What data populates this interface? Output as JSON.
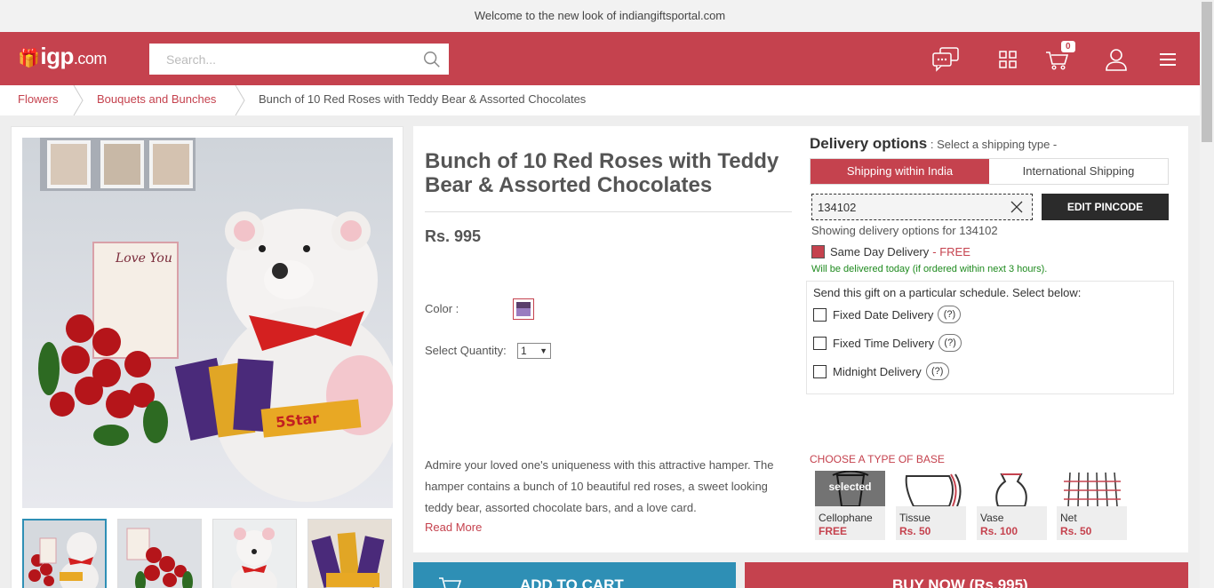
{
  "announcement": "Welcome to the new look of indiangiftsportal.com",
  "header": {
    "logo_main": "igp",
    "logo_suffix": ".com",
    "search_placeholder": "Search...",
    "cart_count": "0",
    "icons": [
      "chat-icon",
      "grid-icon",
      "cart-icon",
      "user-icon",
      "menu-icon"
    ]
  },
  "breadcrumb": {
    "items": [
      "Flowers",
      "Bouquets and Bunches"
    ],
    "current": "Bunch of 10 Red Roses with Teddy Bear & Assorted Chocolates"
  },
  "product": {
    "title": "Bunch of 10 Red Roses with Teddy Bear & Assorted Chocolates",
    "price": "Rs. 995",
    "color_label": "Color :",
    "qty_label": "Select Quantity:",
    "qty_value": "1",
    "description": "Admire your loved one's uniqueness with this attractive hamper. The hamper contains a bunch of 10 beautiful red roses, a sweet looking teddy bear, assorted chocolate bars, and a love card.",
    "read_more": "Read More"
  },
  "delivery": {
    "title": "Delivery options",
    "subtitle": " : Select a shipping type -",
    "tabs": [
      "Shipping within India",
      "International Shipping"
    ],
    "pincode": "134102",
    "edit_button": "EDIT PINCODE",
    "showing_text": "Showing delivery options for 134102",
    "same_day_label": "Same Day Delivery",
    "same_day_price": "- FREE",
    "note": "Will be delivered today (if ordered within next 3 hours).",
    "schedule_head": "Send this gift on a particular schedule. Select below:",
    "schedule_options": [
      "Fixed Date Delivery",
      "Fixed Time Delivery",
      "Midnight Delivery"
    ],
    "help_text": "(?)"
  },
  "base": {
    "title": "CHOOSE A TYPE OF BASE",
    "selected_tag": "selected",
    "options": [
      {
        "name": "Cellophane",
        "price": "FREE"
      },
      {
        "name": "Tissue",
        "price": "Rs. 50"
      },
      {
        "name": "Vase",
        "price": "Rs. 100"
      },
      {
        "name": "Net",
        "price": "Rs. 50"
      }
    ]
  },
  "actions": {
    "add_to_cart": "ADD TO CART",
    "buy_now": "BUY NOW (Rs.995)"
  },
  "colors": {
    "brand": "#c5424e",
    "cart_button": "#2e8fb5",
    "success": "#1e8a1e"
  }
}
